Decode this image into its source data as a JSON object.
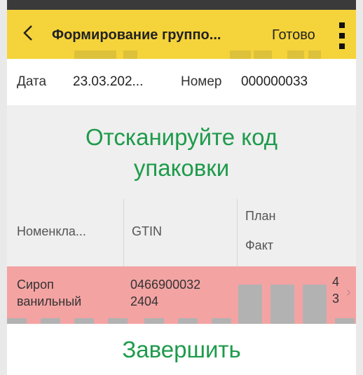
{
  "appbar": {
    "back_icon": "chevron-left-icon",
    "title": "Формирование группо...",
    "done_label": "Готово",
    "menu_icon": "kebab-menu-icon",
    "accent": "#f5d33a"
  },
  "info": {
    "date_label": "Дата",
    "date_value": "23.03.202...",
    "number_label": "Номер",
    "number_value": "000000033"
  },
  "prompt": {
    "line1": "Отсканируйте код",
    "line2": "упаковки",
    "color": "#1e9b4b"
  },
  "table": {
    "headers": {
      "nomenclature": "Номенкла...",
      "gtin": "GTIN",
      "plan": "План",
      "fact": "Факт"
    },
    "rows": [
      {
        "name_line1": "Сироп",
        "name_line2": "ванильный",
        "gtin_line1": "0466900032",
        "gtin_line2": "2404",
        "plan": "4",
        "fact": "3",
        "row_color": "#f4a3a3"
      }
    ]
  },
  "footer": {
    "finish_label": "Завершить"
  }
}
